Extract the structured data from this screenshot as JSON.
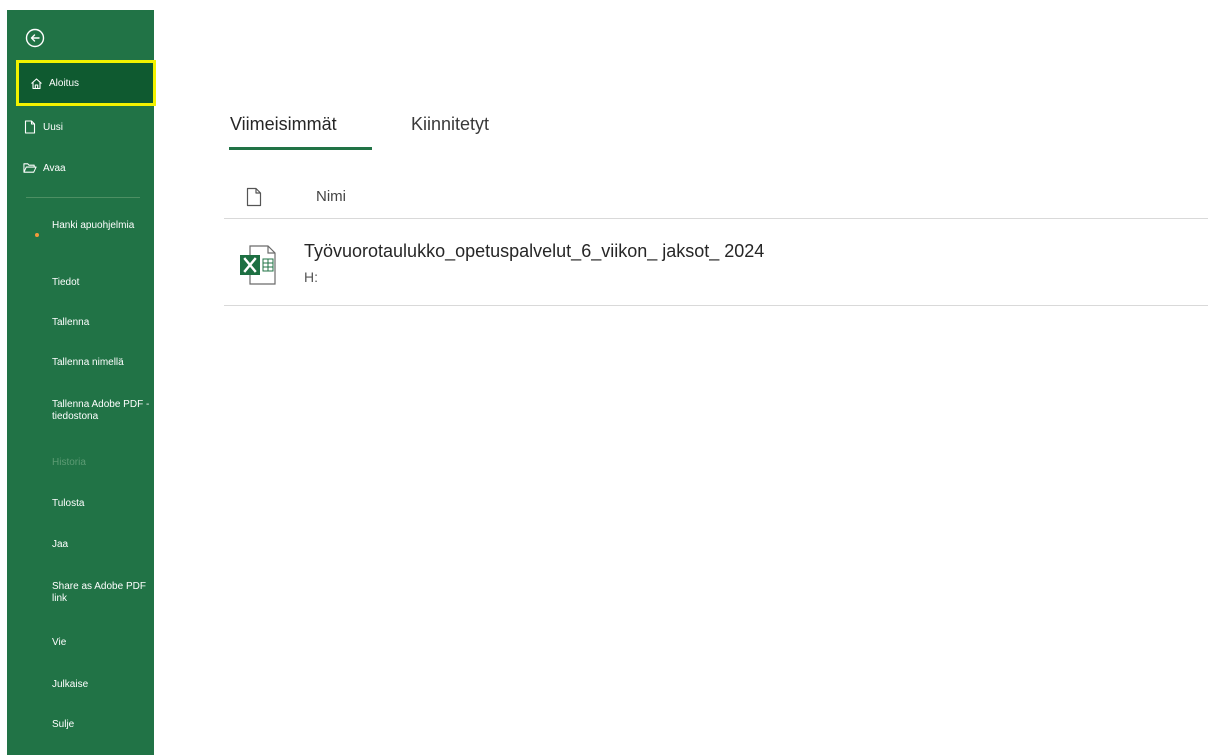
{
  "sidebar": {
    "back_icon": "back-arrow-circle-icon",
    "items_top": [
      {
        "label": "Aloitus",
        "icon": "home-icon",
        "active": true
      },
      {
        "label": "Uusi",
        "icon": "new-document-icon"
      },
      {
        "label": "Avaa",
        "icon": "open-folder-icon"
      }
    ],
    "items": [
      {
        "label": "Hanki apuohjelmia"
      },
      {
        "label": "Tiedot"
      },
      {
        "label": "Tallenna"
      },
      {
        "label": "Tallenna nimellä"
      },
      {
        "label": "Tallenna Adobe PDF -tiedostona"
      },
      {
        "label": "Historia",
        "disabled": true
      },
      {
        "label": "Tulosta"
      },
      {
        "label": "Jaa"
      },
      {
        "label": "Share as Adobe PDF link"
      },
      {
        "label": "Vie"
      },
      {
        "label": "Julkaise"
      },
      {
        "label": "Sulje"
      }
    ]
  },
  "tabs": [
    {
      "label": "Viimeisimmät",
      "selected": true
    },
    {
      "label": "Kiinnitetyt"
    }
  ],
  "table": {
    "header_name": "Nimi",
    "rows": [
      {
        "name": "Työvuorotaulukko_opetuspalvelut_6_viikon_ jaksot_ 2024",
        "path": "H:",
        "icon": "excel-file-icon"
      }
    ]
  },
  "colors": {
    "accent": "#217346",
    "sidebar_active": "#0f5a30",
    "highlight": "#f2f200"
  }
}
